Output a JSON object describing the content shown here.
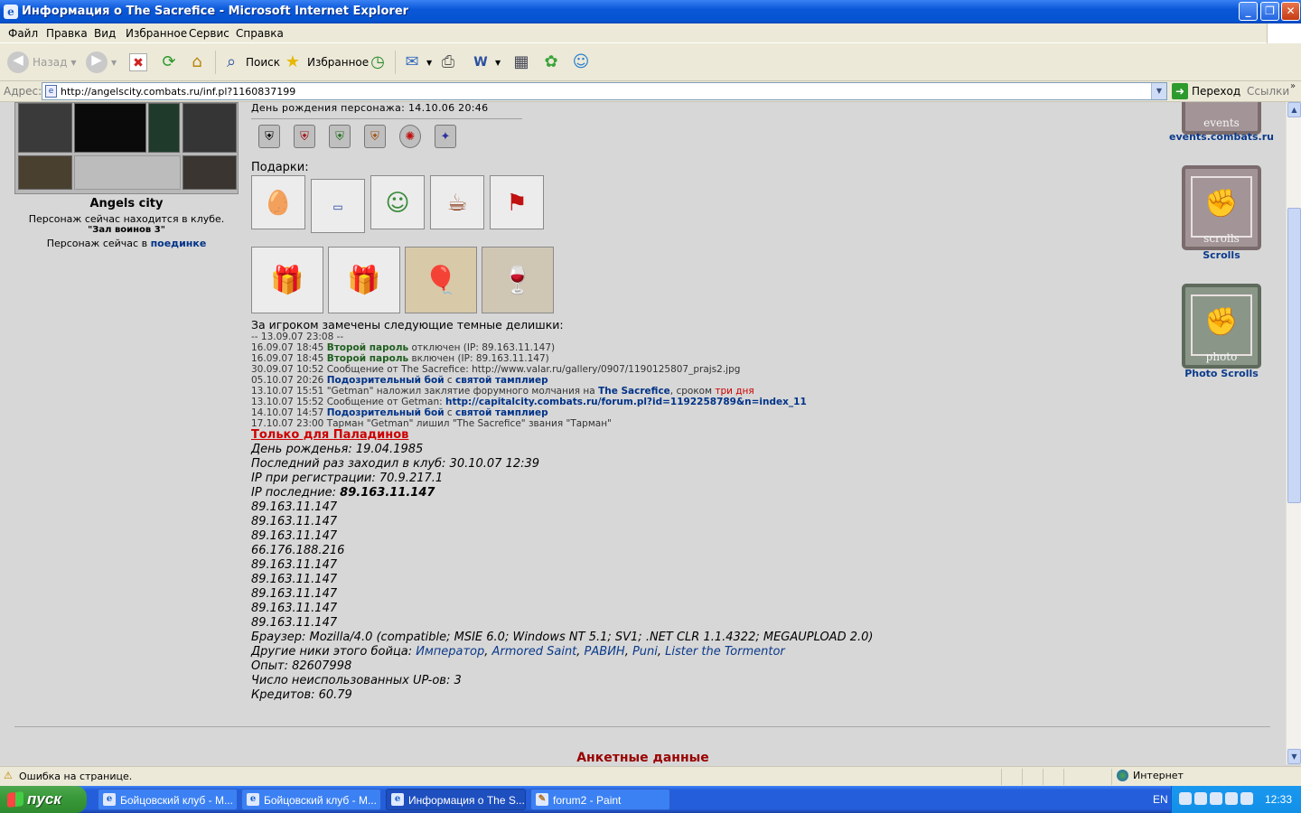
{
  "window": {
    "title": "Информация о The Sacrefice - Microsoft Internet Explorer"
  },
  "menu": [
    "Файл",
    "Правка",
    "Вид",
    "Избранное",
    "Сервис",
    "Справка"
  ],
  "toolbar": {
    "back": "Назад",
    "search": "Поиск",
    "favorites": "Избранное"
  },
  "address": {
    "label": "Адрес:",
    "url": "http://angelscity.combats.ru/inf.pl?1160837199",
    "go": "Переход",
    "links": "Ссылки"
  },
  "left": {
    "city": "Angels city",
    "in_club": "Персонаж сейчас находится в клубе.",
    "room": "\"Зал воинов 3\"",
    "now_in": "Персонаж сейчас в",
    "fight": "поединке"
  },
  "center": {
    "birthday_line": "День рождения персонажа: 14.10.06 20:46",
    "gifts_label": "Подарки:",
    "dark_label": "За игроком замечены следующие темные делишки:",
    "logs": [
      {
        "t": "-- 13.09.07 23:08 --",
        "a": "",
        "b": "",
        "c": "",
        "d": ""
      },
      {
        "t": "16.09.07 18:45",
        "a": "Второй пароль",
        "b": " отключен (IP: 89.163.11.147)",
        "c": "",
        "d": ""
      },
      {
        "t": "16.09.07 18:45",
        "a": "Второй пароль",
        "b": " включен (IP: 89.163.11.147)",
        "c": "",
        "d": ""
      },
      {
        "t": "30.09.07 10:52",
        "a": "",
        "b": "Сообщение от The Sacrefice: http://www.valar.ru/gallery/0907/1190125807_prajs2.jpg",
        "c": "",
        "d": ""
      },
      {
        "t": "05.10.07 20:26",
        "a": "Подозрительный бой",
        "b": " с ",
        "c": "святой тамплиер",
        "d": ""
      },
      {
        "t": "13.10.07 15:51",
        "a": "",
        "b": "\"Getman\" наложил заклятие форумного молчания на ",
        "c": "The Sacrefice",
        "d": ", сроком ",
        "e": "три дня"
      },
      {
        "t": "13.10.07 15:52",
        "a": "",
        "b": "Сообщение от Getman: ",
        "c": "http://capitalcity.combats.ru/forum.pl?id=1192258789&n=index_11",
        "d": ""
      },
      {
        "t": "14.10.07 14:57",
        "a": "Подозрительный бой",
        "b": " с ",
        "c": "святой тамплиер",
        "d": ""
      },
      {
        "t": "17.10.07 23:00",
        "a": "",
        "b": "Тарман \"Getman\" лишил \"The Sacrefice\" звания \"Тарман\"",
        "c": "",
        "d": ""
      }
    ],
    "paladin_header": "Только для Паладинов",
    "birth": "День рожденья: 19.04.1985",
    "last_visit": "Последний раз заходил в клуб: 30.10.07 12:39",
    "reg_ip": "IP при регистрации: 70.9.217.1",
    "last_ip_label": "IP последние:",
    "last_ip_value": "89.163.11.147",
    "ips": [
      "89.163.11.147",
      "89.163.11.147",
      "89.163.11.147",
      "66.176.188.216",
      "89.163.11.147",
      "89.163.11.147",
      "89.163.11.147",
      "89.163.11.147",
      "89.163.11.147"
    ],
    "browser": "Браузер: Mozilla/4.0 (compatible; MSIE 6.0; Windows NT 5.1; SV1; .NET CLR 1.1.4322; MEGAUPLOAD 2.0)",
    "nicks_label": "Другие ники этого бойца:",
    "nicks": [
      "Император",
      "Armored Saint",
      "РАВИН",
      "Puni",
      "Lister the Tormentor"
    ],
    "exp": "Опыт: 82607998",
    "up": "Число неиспользованных UP-ов: 3",
    "credits": "Кредитов: 60.79",
    "anketa": "Анкетные данные"
  },
  "right": {
    "events_text": "events",
    "events_link": "events.combats.ru",
    "scrolls_text": "scrolls",
    "scrolls_link": "Scrolls",
    "photo_text": "photo",
    "photo_link": "Photo Scrolls"
  },
  "status": {
    "message": "Ошибка на странице.",
    "zone": "Интернет"
  },
  "taskbar": {
    "start": "пуск",
    "tasks": [
      "Бойцовский клуб - М...",
      "Бойцовский клуб - М...",
      "Информация о The S...",
      "forum2 - Paint"
    ],
    "lang": "EN",
    "clock": "12:33"
  }
}
